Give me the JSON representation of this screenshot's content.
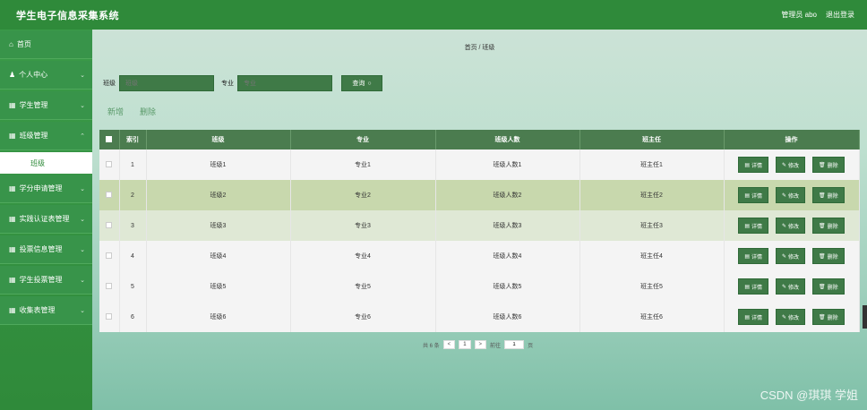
{
  "app": {
    "title": "学生电子信息采集系统",
    "admin_label": "管理员 abo",
    "logout_label": "退出登录"
  },
  "sidebar": {
    "items": [
      {
        "label": "首页",
        "icon": "home-icon",
        "glyph": "⌂",
        "chevron": false
      },
      {
        "label": "个人中心",
        "icon": "user-icon",
        "glyph": "👤",
        "chevron": true
      },
      {
        "label": "学生管理",
        "icon": "grid-icon",
        "glyph": "▦",
        "chevron": true
      },
      {
        "label": "班级管理",
        "icon": "grid-icon",
        "glyph": "▦",
        "chevron": true
      }
    ],
    "sub_item": "班级",
    "items_after": [
      {
        "label": "学分申请管理",
        "icon": "grid-icon",
        "glyph": "▦"
      },
      {
        "label": "实践认证表管理",
        "icon": "grid-icon",
        "glyph": "▦"
      },
      {
        "label": "投票信息管理",
        "icon": "grid-icon",
        "glyph": "▦"
      },
      {
        "label": "学生投票管理",
        "icon": "grid-icon",
        "glyph": "▦"
      },
      {
        "label": "收集表管理",
        "icon": "grid-icon",
        "glyph": "▦"
      }
    ]
  },
  "breadcrumb": "首页 / 班级",
  "search": {
    "class_label": "班级",
    "class_placeholder": "班级",
    "major_label": "专业",
    "major_placeholder": "专业",
    "button_label": "查询"
  },
  "actions": {
    "add_label": "新增",
    "delete_label": "删除"
  },
  "table": {
    "headers": [
      "索引",
      "班级",
      "专业",
      "班级人数",
      "班主任",
      "操作"
    ],
    "rows": [
      {
        "idx": "1",
        "cls": "班级1",
        "major": "专业1",
        "count": "班级人数1",
        "teacher": "班主任1"
      },
      {
        "idx": "2",
        "cls": "班级2",
        "major": "专业2",
        "count": "班级人数2",
        "teacher": "班主任2"
      },
      {
        "idx": "3",
        "cls": "班级3",
        "major": "专业3",
        "count": "班级人数3",
        "teacher": "班主任3"
      },
      {
        "idx": "4",
        "cls": "班级4",
        "major": "专业4",
        "count": "班级人数4",
        "teacher": "班主任4"
      },
      {
        "idx": "5",
        "cls": "班级5",
        "major": "专业5",
        "count": "班级人数5",
        "teacher": "班主任5"
      },
      {
        "idx": "6",
        "cls": "班级6",
        "major": "专业6",
        "count": "班级人数6",
        "teacher": "班主任6"
      }
    ],
    "op_detail": "详情",
    "op_edit": "修改",
    "op_delete": "删除"
  },
  "pager": {
    "total": "共 6 条",
    "prev": "<",
    "page": "1",
    "next": ">",
    "goto_label": "前往",
    "goto_value": "1",
    "page_unit": "页"
  },
  "watermark": "CSDN @琪琪 学姐",
  "colors": {
    "primary": "#2f8a3a",
    "header": "#4b7c4f",
    "button": "#3f7a47",
    "row_highlight": "#c8d8ad"
  }
}
